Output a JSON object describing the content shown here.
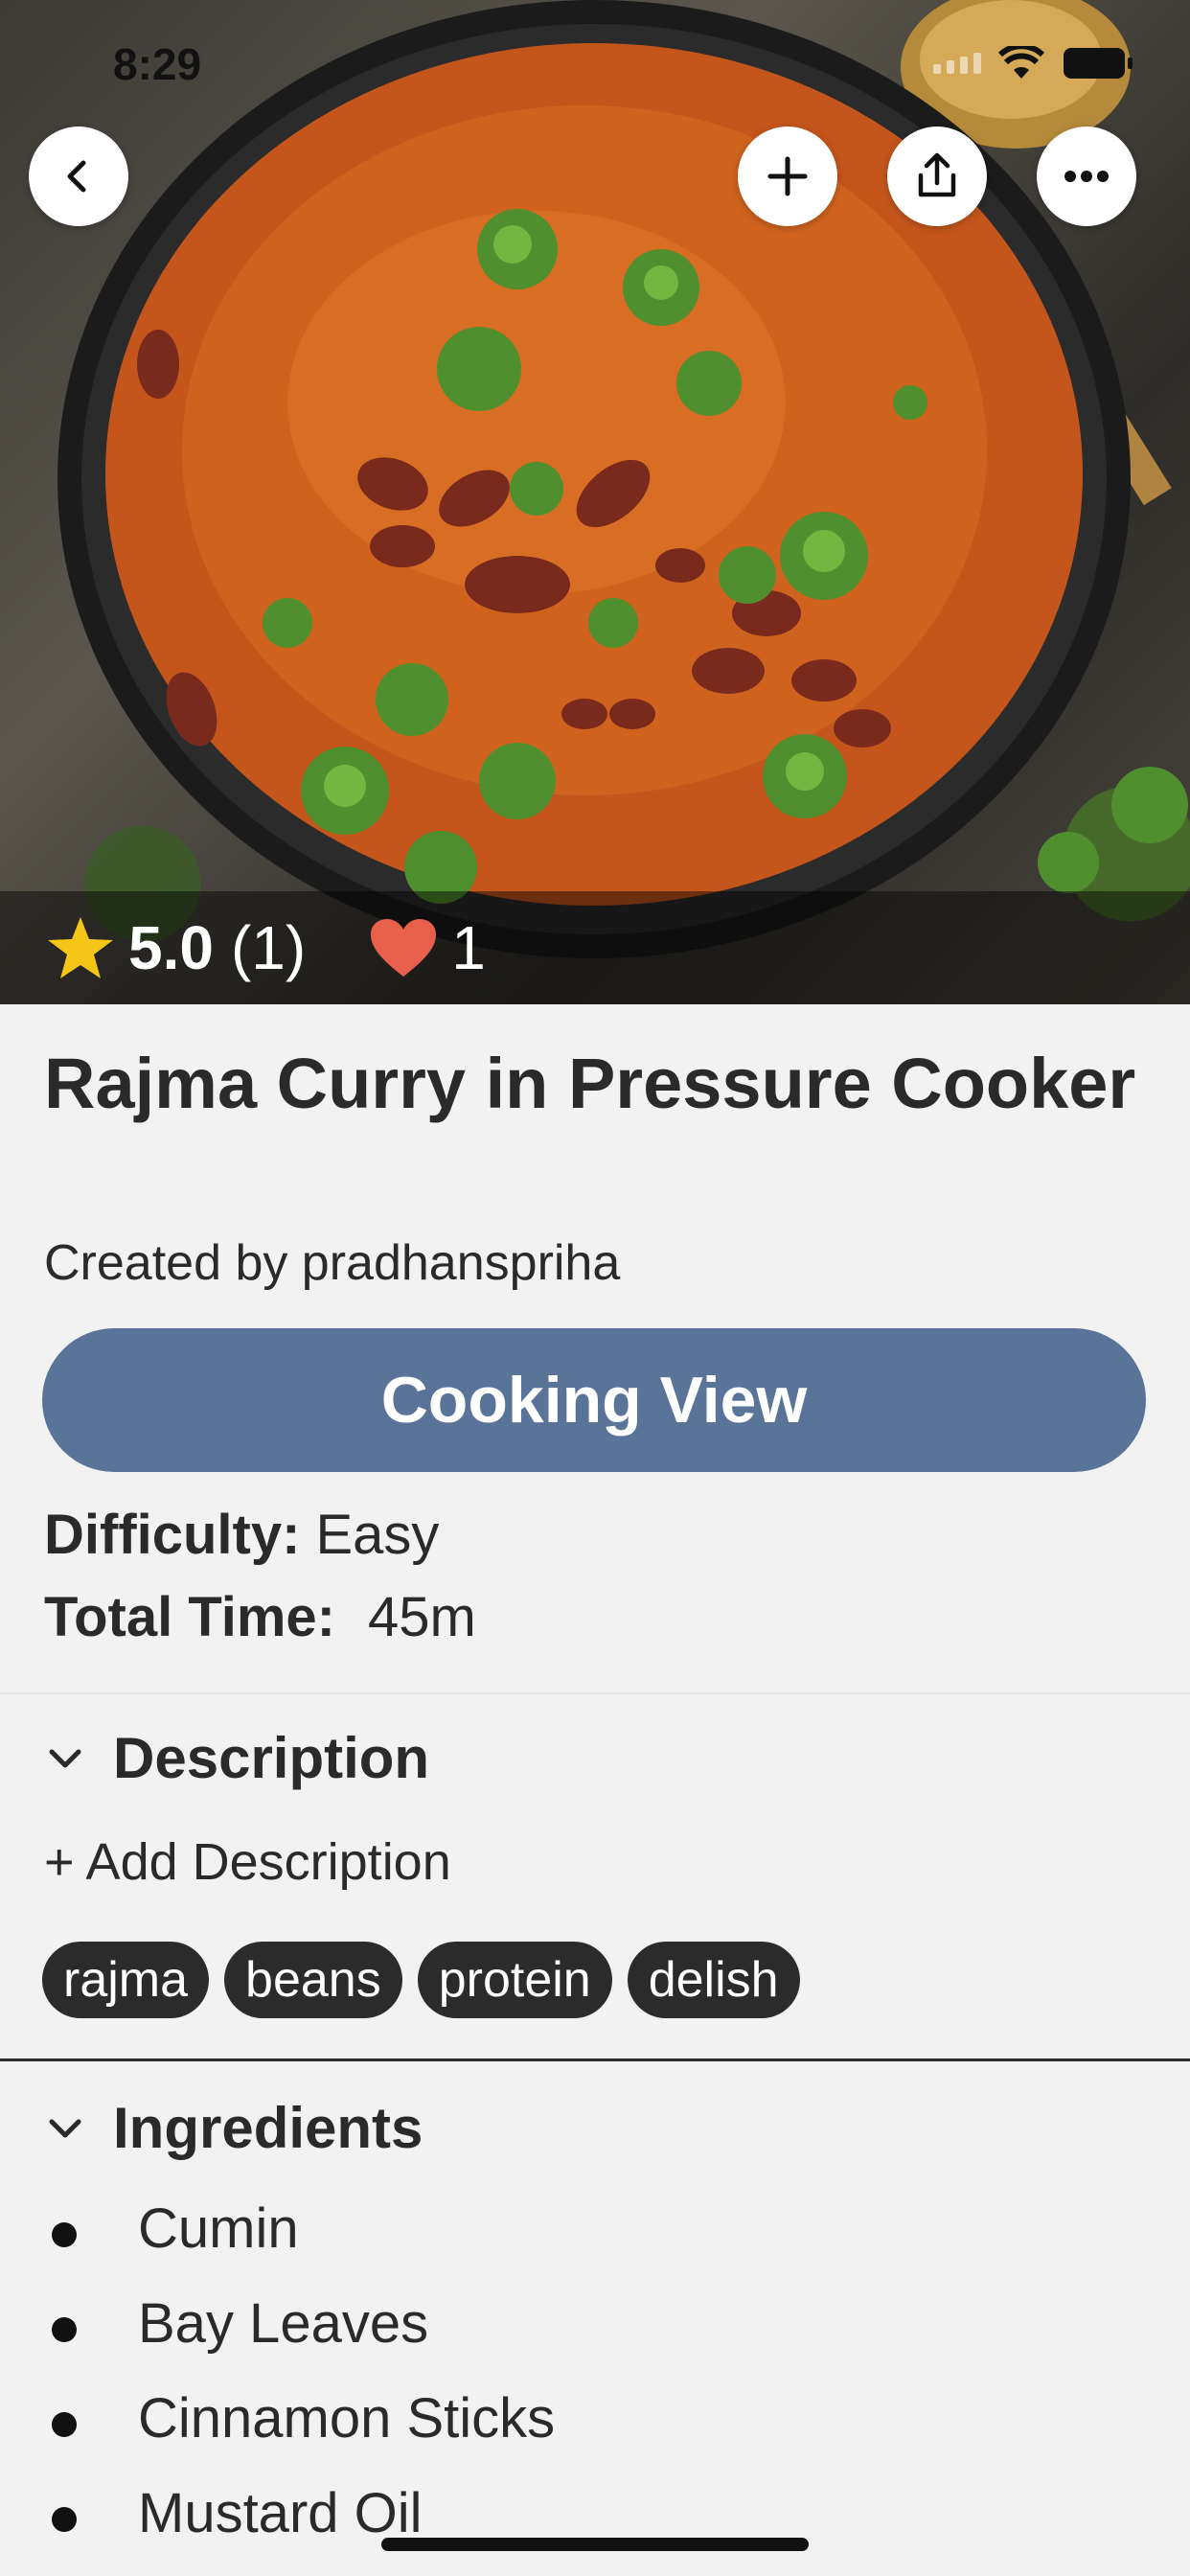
{
  "status_bar": {
    "time": "8:29"
  },
  "hero": {
    "rating": "5.0",
    "rating_count": "(1)",
    "likes": "1",
    "icons": [
      "back-chevron-icon",
      "plus-icon",
      "share-icon",
      "more-icon",
      "star-icon",
      "heart-icon"
    ]
  },
  "recipe": {
    "title": "Rajma Curry in Pressure Cooker",
    "creator": "Created by pradhanspriha",
    "cooking_view_label": "Cooking View",
    "difficulty_label": "Difficulty:",
    "difficulty_value": "Easy",
    "total_time_label": "Total Time:",
    "total_time_value": "45m"
  },
  "description": {
    "header": "Description",
    "add_label": "+ Add Description",
    "tags": [
      "rajma",
      "beans",
      "protein",
      "delish"
    ]
  },
  "ingredients": {
    "header": "Ingredients",
    "items": [
      "Cumin",
      "Bay Leaves",
      "Cinnamon Sticks",
      "Mustard Oil"
    ]
  },
  "colors": {
    "accent_button": "#5a7499",
    "star": "#f5c518",
    "heart": "#e8604c",
    "tag_bg": "#2b2b2b",
    "page_bg": "#f2f2f2"
  }
}
